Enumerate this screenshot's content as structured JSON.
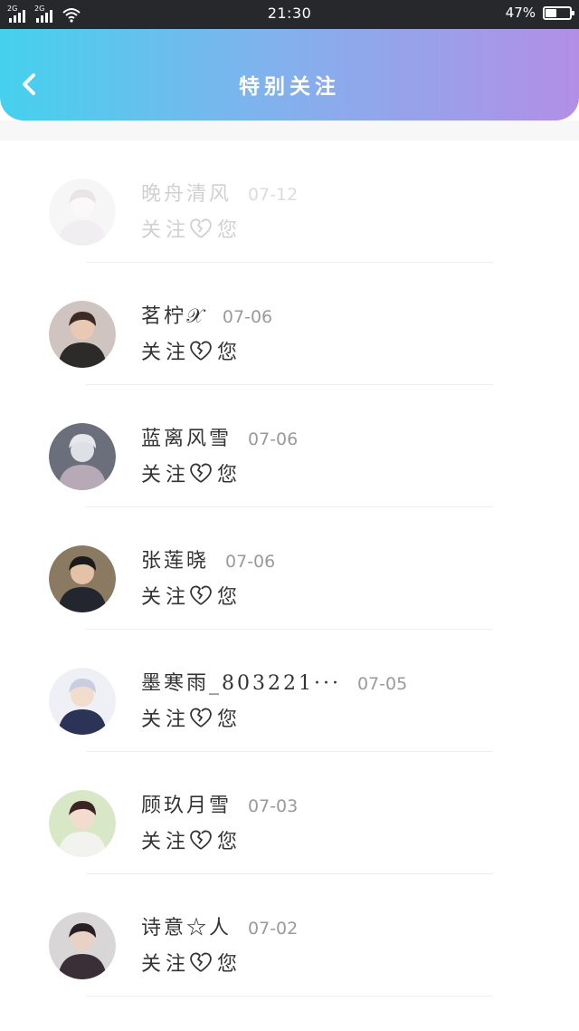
{
  "status_bar": {
    "signal_1": "2G",
    "signal_2": "2G",
    "time": "21:30",
    "battery": "47%",
    "battery_level": 0.47
  },
  "header": {
    "title": "特别关注",
    "back_icon": "chevron-left-icon"
  },
  "colors": {
    "gradient_start": "#45d1ee",
    "gradient_end": "#b28fe6",
    "status_bar": "#26282b"
  },
  "list": [
    {
      "name": "晚舟清风",
      "date": "07-12",
      "msg_a": "关注",
      "msg_b": "您",
      "avatar": "avatar-icon",
      "faded": true
    },
    {
      "name": "茗柠𝒳",
      "date": "07-06",
      "msg_a": "关注",
      "msg_b": "您",
      "avatar": "avatar-icon",
      "faded": false
    },
    {
      "name": "蓝离风雪",
      "date": "07-06",
      "msg_a": "关注",
      "msg_b": "您",
      "avatar": "avatar-icon",
      "faded": false
    },
    {
      "name": "张莲晓",
      "date": "07-06",
      "msg_a": "关注",
      "msg_b": "您",
      "avatar": "avatar-icon",
      "faded": false
    },
    {
      "name": "墨寒雨_803221···",
      "date": "07-05",
      "msg_a": "关注",
      "msg_b": "您",
      "avatar": "avatar-icon",
      "faded": false
    },
    {
      "name": "顾玖月雪",
      "date": "07-03",
      "msg_a": "关注",
      "msg_b": "您",
      "avatar": "avatar-icon",
      "faded": false
    },
    {
      "name": "诗意☆人",
      "date": "07-02",
      "msg_a": "关注",
      "msg_b": "您",
      "avatar": "avatar-icon",
      "faded": false
    }
  ]
}
